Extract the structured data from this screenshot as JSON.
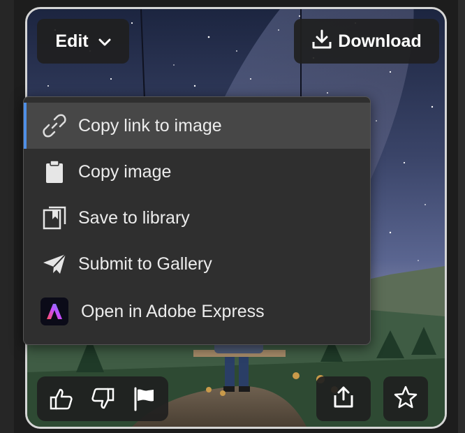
{
  "toolbar": {
    "edit_label": "Edit",
    "download_label": "Download"
  },
  "context_menu": {
    "items": [
      {
        "label": "Copy link to image",
        "icon": "link-icon",
        "highlighted": true
      },
      {
        "label": "Copy image",
        "icon": "clipboard-icon",
        "highlighted": false
      },
      {
        "label": "Save to library",
        "icon": "library-icon",
        "highlighted": false
      },
      {
        "label": "Submit to Gallery",
        "icon": "paper-plane-icon",
        "highlighted": false
      },
      {
        "label": "Open in Adobe Express",
        "icon": "adobe-express-logo",
        "highlighted": false
      }
    ]
  },
  "bottom_actions": {
    "feedback": [
      "thumbs-up-icon",
      "thumbs-down-icon",
      "flag-icon"
    ],
    "share": "share-icon",
    "favorite": "star-icon"
  },
  "colors": {
    "menu_bg": "#2f2f2f",
    "menu_highlight": "#474747",
    "focus_accent": "#4f8fe6",
    "button_bg": "#202020",
    "card_border": "#d6d6d6"
  }
}
